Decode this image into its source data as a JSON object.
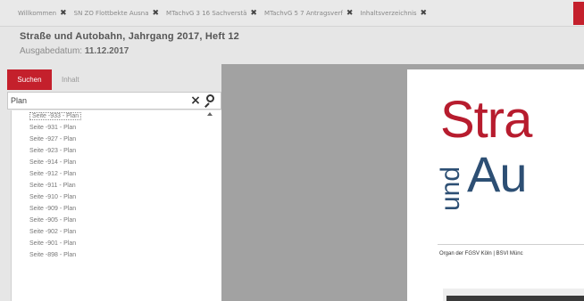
{
  "tabs": [
    {
      "label": "Willkommen"
    },
    {
      "label": "SN ZO Flottbekte Ausna"
    },
    {
      "label": "MTachvG 3 16 Sachverstä"
    },
    {
      "label": "MTachvG 5 7 Antragsverf"
    },
    {
      "label": "Inhaltsverzeichnis"
    }
  ],
  "header": {
    "title": "Straße und Autobahn, Jahrgang 2017, Heft 12",
    "date_label": "Ausgabedatum:",
    "date_value": "11.12.2017"
  },
  "left_tabs": {
    "search": "Suchen",
    "content": "Inhalt"
  },
  "search": {
    "value": "Plan",
    "placeholder": ""
  },
  "results": [
    "Seite -933 - Plan",
    "Seite -931 - Plan",
    "Seite -927 - Plan",
    "Seite -923 - Plan",
    "Seite -914 - Plan",
    "Seite -912 - Plan",
    "Seite -911 - Plan",
    "Seite -910 - Plan",
    "Seite -909 - Plan",
    "Seite -905 - Plan",
    "Seite -902 - Plan",
    "Seite -901 - Plan",
    "Seite -898 - Plan"
  ],
  "page_preview": {
    "title_top": "Stra",
    "title_side": "und",
    "title_bottom": "Au",
    "organ": "Organ der FGSV Köln | BSVI Münc"
  },
  "colors": {
    "accent": "#c4202c",
    "brand_red": "#b71c2e",
    "brand_blue": "#2d4f74"
  }
}
